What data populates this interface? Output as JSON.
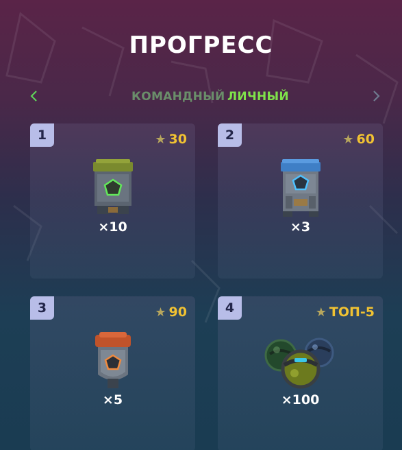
{
  "header": {
    "title": "ПРОГРЕСС"
  },
  "tabs": [
    {
      "label": "КОМАНДНЫЙ",
      "active": false
    },
    {
      "label": "ЛИЧНЫЙ",
      "active": true
    }
  ],
  "nav": {
    "prev_icon": "chevron-left-icon",
    "next_icon": "chevron-right-icon"
  },
  "rewards": [
    {
      "rank": "1",
      "cost": "30",
      "qty": "×10",
      "item_icon": "green-container-icon"
    },
    {
      "rank": "2",
      "cost": "60",
      "qty": "×3",
      "item_icon": "blue-container-icon"
    },
    {
      "rank": "3",
      "cost": "90",
      "qty": "×5",
      "item_icon": "orange-container-icon"
    },
    {
      "rank": "4",
      "cost": "ТОП-5",
      "qty": "×100",
      "item_icon": "spheres-icon"
    }
  ],
  "colors": {
    "accent_active_tab": "#7fe24a",
    "cost_text": "#f1c232",
    "rank_badge": "#b8bde8"
  }
}
